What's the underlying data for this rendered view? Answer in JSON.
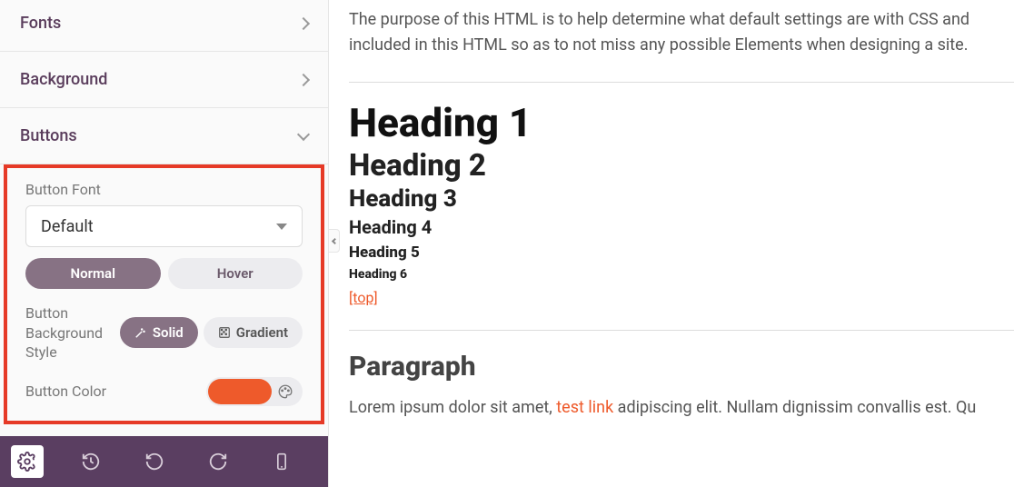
{
  "sidebar": {
    "panels": {
      "fonts": {
        "label": "Fonts"
      },
      "background": {
        "label": "Background"
      },
      "buttons": {
        "label": "Buttons"
      }
    },
    "buttons_panel": {
      "font_label": "Button Font",
      "font_value": "Default",
      "state_tabs": {
        "normal": "Normal",
        "hover": "Hover"
      },
      "bg_style_label": "Button Background Style",
      "bg_styles": {
        "solid": "Solid",
        "gradient": "Gradient"
      },
      "color_label": "Button Color",
      "color_value": "#ee5a2b"
    }
  },
  "icons": {
    "gear": "gear-icon",
    "history": "history-icon",
    "undo": "undo-icon",
    "redo": "redo-icon",
    "mobile": "mobile-icon",
    "wand": "wand-icon",
    "grad": "gradient-icon",
    "palette": "palette-icon"
  },
  "preview": {
    "intro": "The purpose of this HTML is to help determine what default settings are with CSS and included in this HTML so as to not miss any possible Elements when designing a site.",
    "h1": "Heading 1",
    "h2": "Heading 2",
    "h3": "Heading 3",
    "h4": "Heading 4",
    "h5": "Heading 5",
    "h6": "Heading 6",
    "top_link": "[top]",
    "para_heading": "Paragraph",
    "para_before": "Lorem ipsum dolor sit amet, ",
    "para_link": "test link",
    "para_after": " adipiscing elit. Nullam dignissim convallis est. Qu"
  }
}
